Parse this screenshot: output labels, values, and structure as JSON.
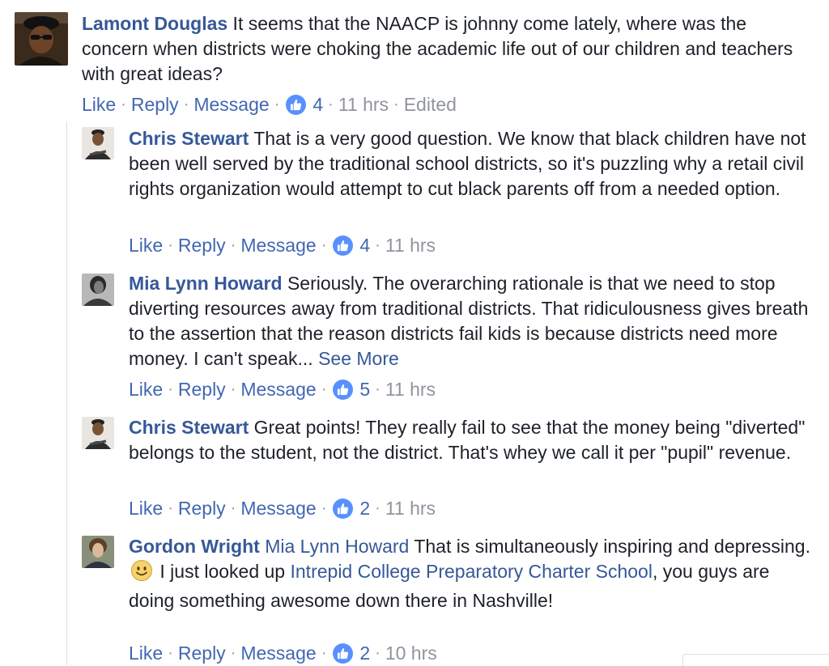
{
  "actions": {
    "like": "Like",
    "reply": "Reply",
    "message": "Message",
    "separator": "·"
  },
  "comments": [
    {
      "author": "Lamont Douglas",
      "text": " It seems that the NAACP is johnny come lately, where was the concern when districts were choking the academic life out of our children and teachers with great ideas?",
      "likes": "4",
      "time": "11 hrs",
      "edited": "Edited",
      "avatar_icon": "profile-photo-icon"
    },
    {
      "author": "Chris Stewart",
      "text": " That is a very good question. We know that black children have not been well served by the traditional school districts, so it's puzzling why a retail civil rights organization would attempt to cut black parents off from a needed option.",
      "likes": "4",
      "time": "11 hrs",
      "avatar_icon": "profile-photo-icon"
    },
    {
      "author": "Mia Lynn Howard",
      "text": " Seriously. The overarching rationale is that we need to stop diverting resources away from traditional districts. That ridiculousness gives breath to the assertion that the reason districts fail kids is because districts need more money. I can't speak... ",
      "see_more": "See More",
      "likes": "5",
      "time": "11 hrs",
      "avatar_icon": "profile-photo-icon"
    },
    {
      "author": "Chris Stewart",
      "text": " Great points! They really fail to see that the money being \"diverted\" belongs to the student, not the district. That's whey we call it per \"pupil\" revenue.",
      "likes": "2",
      "time": "11 hrs",
      "avatar_icon": "profile-photo-icon"
    },
    {
      "author": "Gordon Wright",
      "mention": "Mia Lynn Howard",
      "text_a": " That is simultaneously inspiring and depressing. ",
      "emoji": "smiley-emoji-icon",
      "text_b": " I just looked up ",
      "link": "Intrepid College Preparatory Charter School",
      "text_c": ", you guys are doing something awesome down there in Nashville!",
      "likes": "2",
      "time": "10 hrs",
      "avatar_icon": "profile-photo-icon"
    }
  ],
  "colors": {
    "author": "#365899",
    "action": "#4267b2",
    "like_badge": "#5890ff",
    "meta": "#90949c",
    "text": "#1d2129"
  }
}
